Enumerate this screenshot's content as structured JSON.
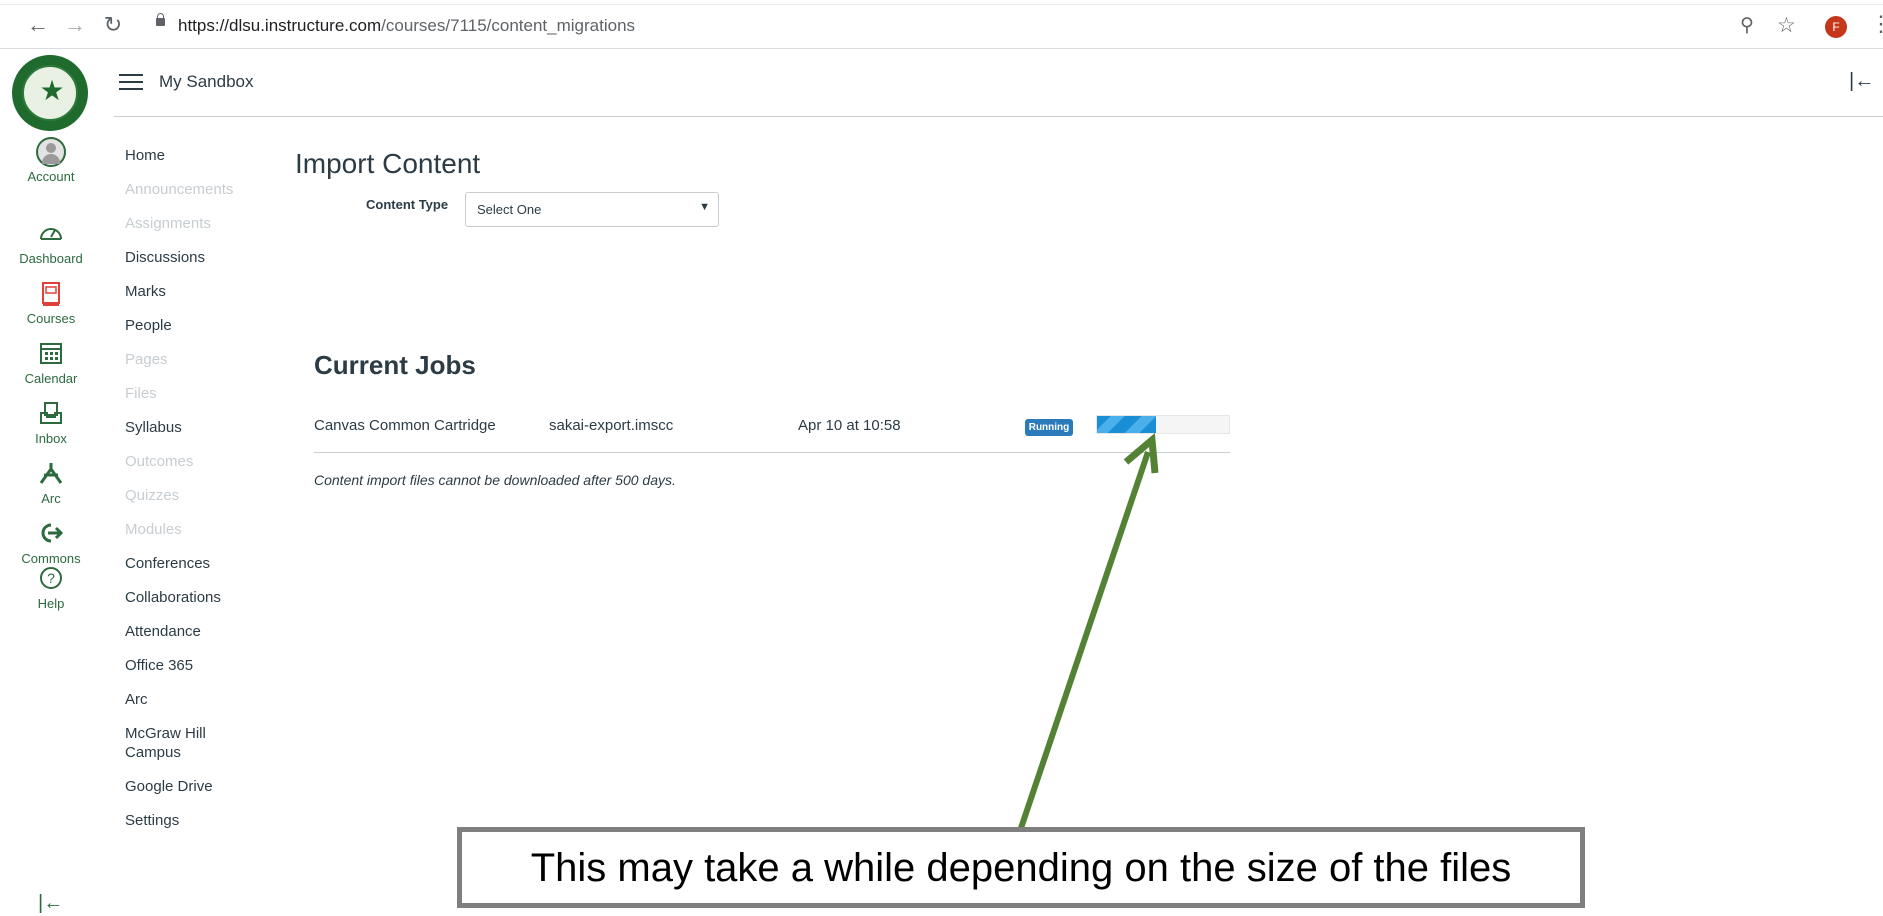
{
  "browser": {
    "url_host": "https://dlsu.instructure.com",
    "url_path": "/courses/7115/content_migrations",
    "profile_initial": "F"
  },
  "global_nav": {
    "items": [
      {
        "label": "Account",
        "icon": "account-icon"
      },
      {
        "label": "Dashboard",
        "icon": "dashboard-icon"
      },
      {
        "label": "Courses",
        "icon": "courses-icon"
      },
      {
        "label": "Calendar",
        "icon": "calendar-icon"
      },
      {
        "label": "Inbox",
        "icon": "inbox-icon"
      },
      {
        "label": "Arc",
        "icon": "arc-icon"
      },
      {
        "label": "Commons",
        "icon": "commons-icon"
      },
      {
        "label": "Help",
        "icon": "help-icon"
      }
    ],
    "accent_color": "#2d6a3e"
  },
  "header": {
    "breadcrumb": "My Sandbox"
  },
  "course_nav": {
    "items": [
      {
        "label": "Home",
        "enabled": true
      },
      {
        "label": "Announcements",
        "enabled": false
      },
      {
        "label": "Assignments",
        "enabled": false
      },
      {
        "label": "Discussions",
        "enabled": true
      },
      {
        "label": "Marks",
        "enabled": true
      },
      {
        "label": "People",
        "enabled": true
      },
      {
        "label": "Pages",
        "enabled": false
      },
      {
        "label": "Files",
        "enabled": false
      },
      {
        "label": "Syllabus",
        "enabled": true
      },
      {
        "label": "Outcomes",
        "enabled": false
      },
      {
        "label": "Quizzes",
        "enabled": false
      },
      {
        "label": "Modules",
        "enabled": false
      },
      {
        "label": "Conferences",
        "enabled": true
      },
      {
        "label": "Collaborations",
        "enabled": true
      },
      {
        "label": "Attendance",
        "enabled": true
      },
      {
        "label": "Office 365",
        "enabled": true
      },
      {
        "label": "Arc",
        "enabled": true
      },
      {
        "label": "McGraw Hill Campus",
        "enabled": true
      },
      {
        "label": "Google Drive",
        "enabled": true
      },
      {
        "label": "Settings",
        "enabled": true
      }
    ]
  },
  "main": {
    "title": "Import Content",
    "content_type_label": "Content Type",
    "content_type_value": "Select One",
    "jobs_title": "Current Jobs",
    "job": {
      "type": "Canvas Common Cartridge",
      "file": "sakai-export.imscc",
      "date": "Apr 10 at 10:58",
      "status": "Running",
      "progress": 0.45
    },
    "note": "Content import files cannot be downloaded after 500 days."
  },
  "annotation": {
    "text": "This may take a while depending on the size of the files",
    "arrow_color": "#548235"
  }
}
